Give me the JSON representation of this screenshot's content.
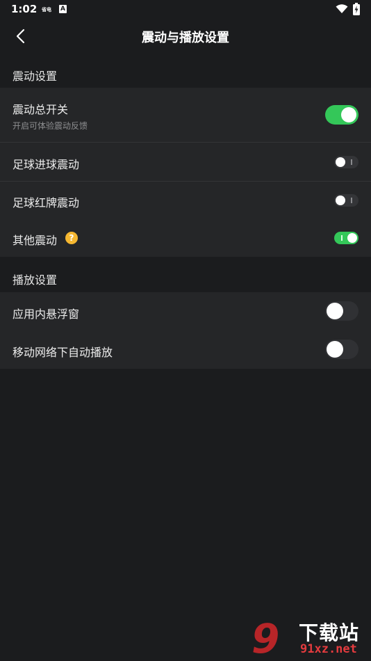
{
  "status_bar": {
    "time": "1:02",
    "notification_text": "省电",
    "notification_icon": "A"
  },
  "header": {
    "title": "震动与播放设置",
    "back_icon": "chevron-left-icon"
  },
  "sections": [
    {
      "header": "震动设置",
      "items": [
        {
          "title": "震动总开关",
          "subtitle": "开启可体验震动反馈",
          "toggle": "on",
          "toggle_size": "large"
        },
        {
          "title": "足球进球震动",
          "toggle": "off",
          "toggle_size": "small"
        },
        {
          "title": "足球红牌震动",
          "toggle": "off",
          "toggle_size": "small"
        },
        {
          "title": "其他震动",
          "help_icon": "?",
          "toggle": "on",
          "toggle_size": "small"
        }
      ]
    },
    {
      "header": "播放设置",
      "items": [
        {
          "title": "应用内悬浮窗",
          "toggle": "off",
          "toggle_size": "large"
        },
        {
          "title": "移动网络下自动播放",
          "toggle": "off",
          "toggle_size": "large"
        }
      ]
    }
  ],
  "watermark": {
    "logo": "9",
    "cn_text": "下载站",
    "en_text": "91xz.net"
  },
  "colors": {
    "background": "#1b1c1e",
    "card": "#252628",
    "toggle_on": "#34c759",
    "toggle_off": "#303134",
    "help_badge": "#f5b731"
  }
}
